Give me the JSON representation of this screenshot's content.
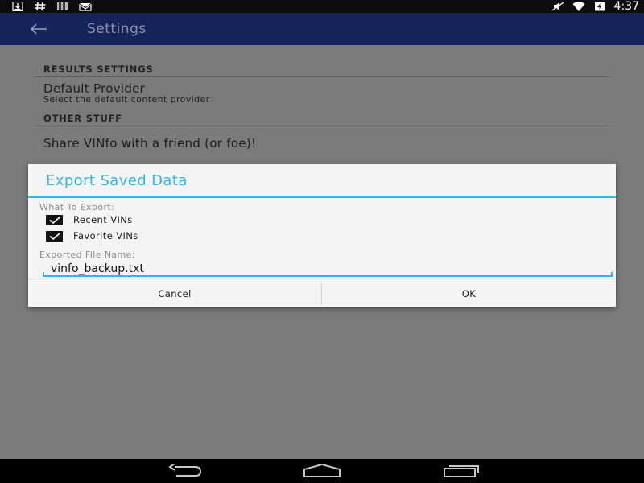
{
  "status_bar": {
    "time": "4:37",
    "left_icons": [
      "download-icon",
      "hash-icon",
      "barcode-icon",
      "mail-icon"
    ],
    "right_icons": [
      "mute-icon",
      "wifi-icon",
      "battery-charging-icon"
    ]
  },
  "app_bar": {
    "title": "Settings",
    "background_color": "#15255c"
  },
  "settings": {
    "results_header": "RESULTS SETTINGS",
    "default_provider": {
      "title": "Default Provider",
      "summary": "Select the default content provider"
    },
    "other_header": "OTHER STUFF",
    "share_item": "Share VINfo with a friend (or foe)!"
  },
  "dialog": {
    "title": "Export Saved Data",
    "accent_color": "#33b5e5",
    "what_label": "What To Export:",
    "options": [
      {
        "label": "Recent VINs",
        "checked": true
      },
      {
        "label": "Favorite VINs",
        "checked": true
      }
    ],
    "file_label": "Exported File Name:",
    "file_value": "vinfo_backup.txt",
    "cancel_label": "Cancel",
    "ok_label": "OK"
  },
  "nav_bar": {
    "icons": [
      "back-icon",
      "home-icon",
      "recent-apps-icon"
    ]
  }
}
